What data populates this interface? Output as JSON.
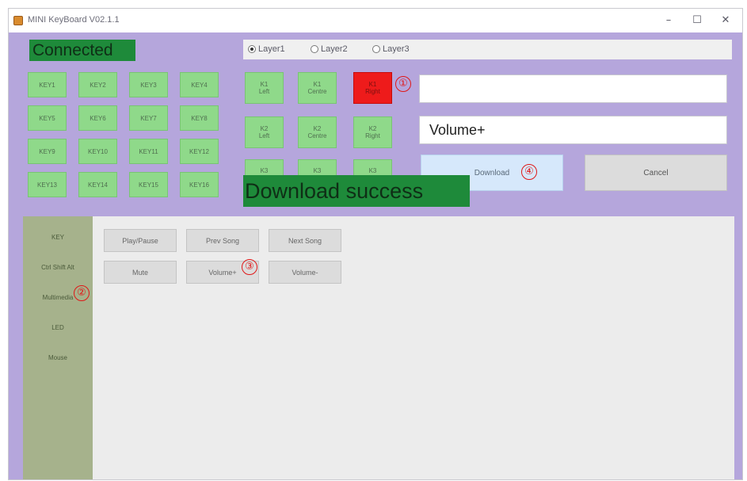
{
  "window": {
    "title": "MINI KeyBoard V02.1.1",
    "minimize": "–",
    "maximize": "☐",
    "close": "✕"
  },
  "status_connected": "Connected",
  "layers": [
    {
      "label": "Layer1",
      "checked": true
    },
    {
      "label": "Layer2",
      "checked": false
    },
    {
      "label": "Layer3",
      "checked": false
    }
  ],
  "keys": [
    "KEY1",
    "KEY2",
    "KEY3",
    "KEY4",
    "KEY5",
    "KEY6",
    "KEY7",
    "KEY8",
    "KEY9",
    "KEY10",
    "KEY11",
    "KEY12",
    "KEY13",
    "KEY14",
    "KEY15",
    "KEY16"
  ],
  "knobs": [
    {
      "line1": "K1",
      "line2": "Left"
    },
    {
      "line1": "K1",
      "line2": "Centre"
    },
    {
      "line1": "K1",
      "line2": "Right"
    },
    {
      "line1": "K2",
      "line2": "Left"
    },
    {
      "line1": "K2",
      "line2": "Centre"
    },
    {
      "line1": "K2",
      "line2": "Right"
    },
    {
      "line1": "K3",
      "line2": ""
    },
    {
      "line1": "K3",
      "line2": ""
    },
    {
      "line1": "K3",
      "line2": ""
    }
  ],
  "textbox_top": "",
  "textbox_value": "Volume+",
  "buttons": {
    "download": "Download",
    "cancel": "Cancel"
  },
  "download_status": "Download success",
  "sidebar": [
    "KEY",
    "Ctrl Shift Alt",
    "Multimedia",
    "LED",
    "Mouse"
  ],
  "functions": [
    "Play/Pause",
    "Prev Song",
    "Next Song",
    "Mute",
    "Volume+",
    "Volume-"
  ],
  "markers": [
    "①",
    "②",
    "③",
    "④"
  ],
  "colors": {
    "panel": "#b5a6dc",
    "key_green": "#8fd98a",
    "active_red": "#ee1b1b",
    "status_green": "#1e8a3a",
    "sidebar": "#a6b28c",
    "marker": "#e01818"
  }
}
